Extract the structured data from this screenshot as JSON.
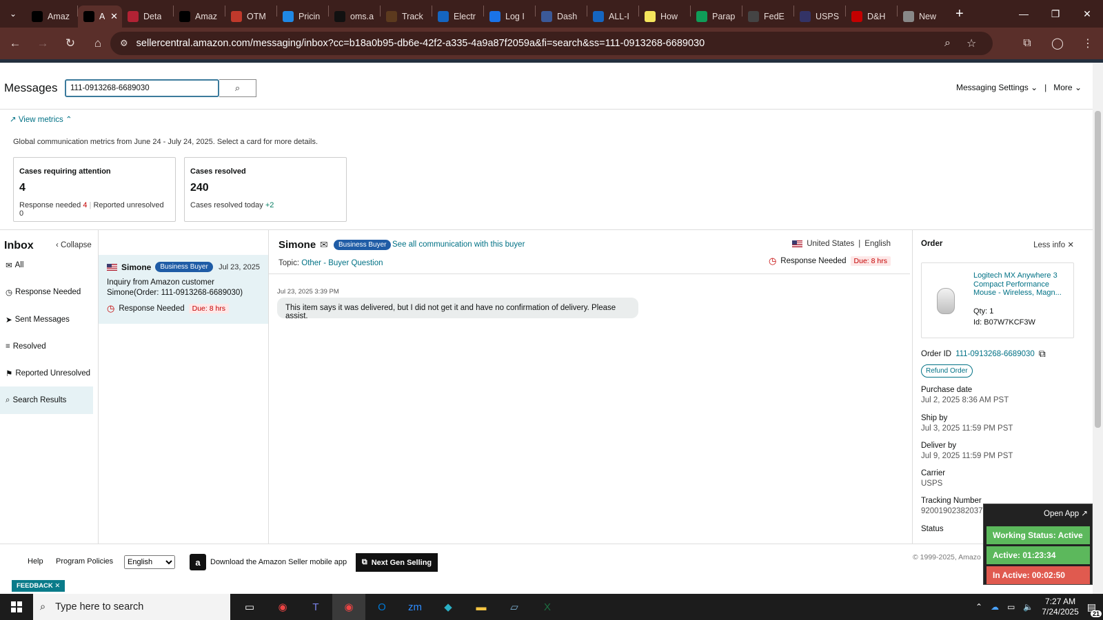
{
  "browser": {
    "tabs": [
      {
        "title": "Amaz",
        "icon": "amazon-a-icon",
        "color": "#000000"
      },
      {
        "title": "A",
        "icon": "amazon-a-icon",
        "color": "#000000",
        "active": true
      },
      {
        "title": "Deta",
        "icon": "flag-icon",
        "color": "#b22234"
      },
      {
        "title": "Amaz",
        "icon": "amazon-a-icon",
        "color": "#000000"
      },
      {
        "title": "OTM",
        "icon": "otm-icon",
        "color": "#c0392b"
      },
      {
        "title": "Pricin",
        "icon": "pricing-icon",
        "color": "#1f88e5"
      },
      {
        "title": "oms.a",
        "icon": "triangle-icon",
        "color": "#111111"
      },
      {
        "title": "Track",
        "icon": "ups-icon",
        "color": "#5c3a1e"
      },
      {
        "title": "Electr",
        "icon": "ec-icon",
        "color": "#1565c0"
      },
      {
        "title": "Log I",
        "icon": "g-icon",
        "color": "#1a73e8"
      },
      {
        "title": "Dash",
        "icon": "dash-icon",
        "color": "#3b5998"
      },
      {
        "title": "ALL-I",
        "icon": "seventeen-track-icon",
        "color": "#1565c0"
      },
      {
        "title": "How",
        "icon": "bulb-icon",
        "color": "#f4e55c"
      },
      {
        "title": "Parap",
        "icon": "sheets-icon",
        "color": "#0f9d58"
      },
      {
        "title": "FedE",
        "icon": "chatgpt-icon",
        "color": "#444444"
      },
      {
        "title": "USPS",
        "icon": "usps-icon",
        "color": "#333366"
      },
      {
        "title": "D&H",
        "icon": "dh-icon",
        "color": "#c40000"
      },
      {
        "title": "New",
        "icon": "new-tab-icon",
        "color": "#888888"
      }
    ],
    "url": "sellercentral.amazon.com/messaging/inbox?cc=b18a0b95-db6e-42f2-a335-4a9a87f2059a&fi=search&ss=111-0913268-6689030"
  },
  "header": {
    "title": "Messages",
    "search_value": "111-0913268-6689030",
    "settings_label": "Messaging Settings",
    "more_label": "More"
  },
  "metrics": {
    "toggle_label": "View metrics",
    "note": "Global communication metrics from June 24 - July 24, 2025. Select a card for more details.",
    "cards": [
      {
        "title": "Cases requiring attention",
        "value": "4",
        "sub_a_label": "Response needed",
        "sub_a_value": "4",
        "sub_b_label": "Reported unresolved",
        "sub_b_value": "0"
      },
      {
        "title": "Cases resolved",
        "value": "240",
        "sub_a_label": "Cases resolved today",
        "sub_a_value": "+2"
      }
    ]
  },
  "inbox": {
    "title": "Inbox",
    "collapse_label": "Collapse",
    "items": [
      {
        "label": "All",
        "icon": "mail-icon"
      },
      {
        "label": "Response Needed",
        "icon": "clock-icon"
      },
      {
        "label": "Sent Messages",
        "icon": "send-icon"
      },
      {
        "label": "Resolved",
        "icon": "resolved-list-icon"
      },
      {
        "label": "Reported Unresolved",
        "icon": "person-flag-icon"
      },
      {
        "label": "Search Results",
        "icon": "search-icon",
        "selected": true
      }
    ]
  },
  "list": {
    "card": {
      "name": "Simone",
      "badge": "Business Buyer",
      "date": "Jul 23, 2025",
      "line1": "Inquiry from Amazon customer",
      "line2": "Simone(Order: 111-0913268-6689030)",
      "status": "Response Needed",
      "due": "Due: 8 hrs"
    }
  },
  "conversation": {
    "name": "Simone",
    "badge": "Business Buyer",
    "see_all": "See all communication with this buyer",
    "topic_label": "Topic:",
    "topic_value": "Other - Buyer Question",
    "country": "United States",
    "separator": "|",
    "language": "English",
    "status": "Response Needed",
    "due": "Due: 8 hrs",
    "message_time": "Jul 23, 2025 3:39 PM",
    "message_text": "This item says it was delivered, but I did not get it and have no confirmation of delivery. Please assist."
  },
  "order": {
    "title": "Order",
    "less_info": "Less info",
    "product_name": "Logitech MX Anywhere 3 Compact Performance Mouse - Wireless, Magn...",
    "qty": "Qty: 1",
    "product_id": "Id: B07W7KCF3W",
    "order_id_label": "Order ID",
    "order_id": "111-0913268-6689030",
    "refund_label": "Refund Order",
    "fields": [
      {
        "k": "Purchase date",
        "v": "Jul 2, 2025 8:36 AM PST"
      },
      {
        "k": "Ship by",
        "v": "Jul 3, 2025 11:59 PM PST"
      },
      {
        "k": "Deliver by",
        "v": "Jul 9, 2025 11:59 PM PST"
      },
      {
        "k": "Carrier",
        "v": "USPS"
      },
      {
        "k": "Tracking Number",
        "v": "9200190238203781167097"
      },
      {
        "k": "Status",
        "v": ""
      }
    ]
  },
  "footer": {
    "help": "Help",
    "policies": "Program Policies",
    "language_option": "English",
    "app_download": "Download the Amazon Seller mobile app",
    "next_gen": "Next Gen Selling",
    "copyright": "© 1999-2025, Amazo",
    "feedback": "FEEDBACK"
  },
  "widget": {
    "open_app": "Open App ↗",
    "working_status": "Working Status: Active",
    "active": "Active: 01:23:34",
    "inactive": "In Active: 00:02:50",
    "colors": {
      "working": "#5cb85c",
      "active": "#5cb85c",
      "inactive": "#e05a4f"
    }
  },
  "taskbar": {
    "search_placeholder": "Type here to search",
    "time": "7:27 AM",
    "date": "7/24/2025",
    "notifications": "21"
  }
}
